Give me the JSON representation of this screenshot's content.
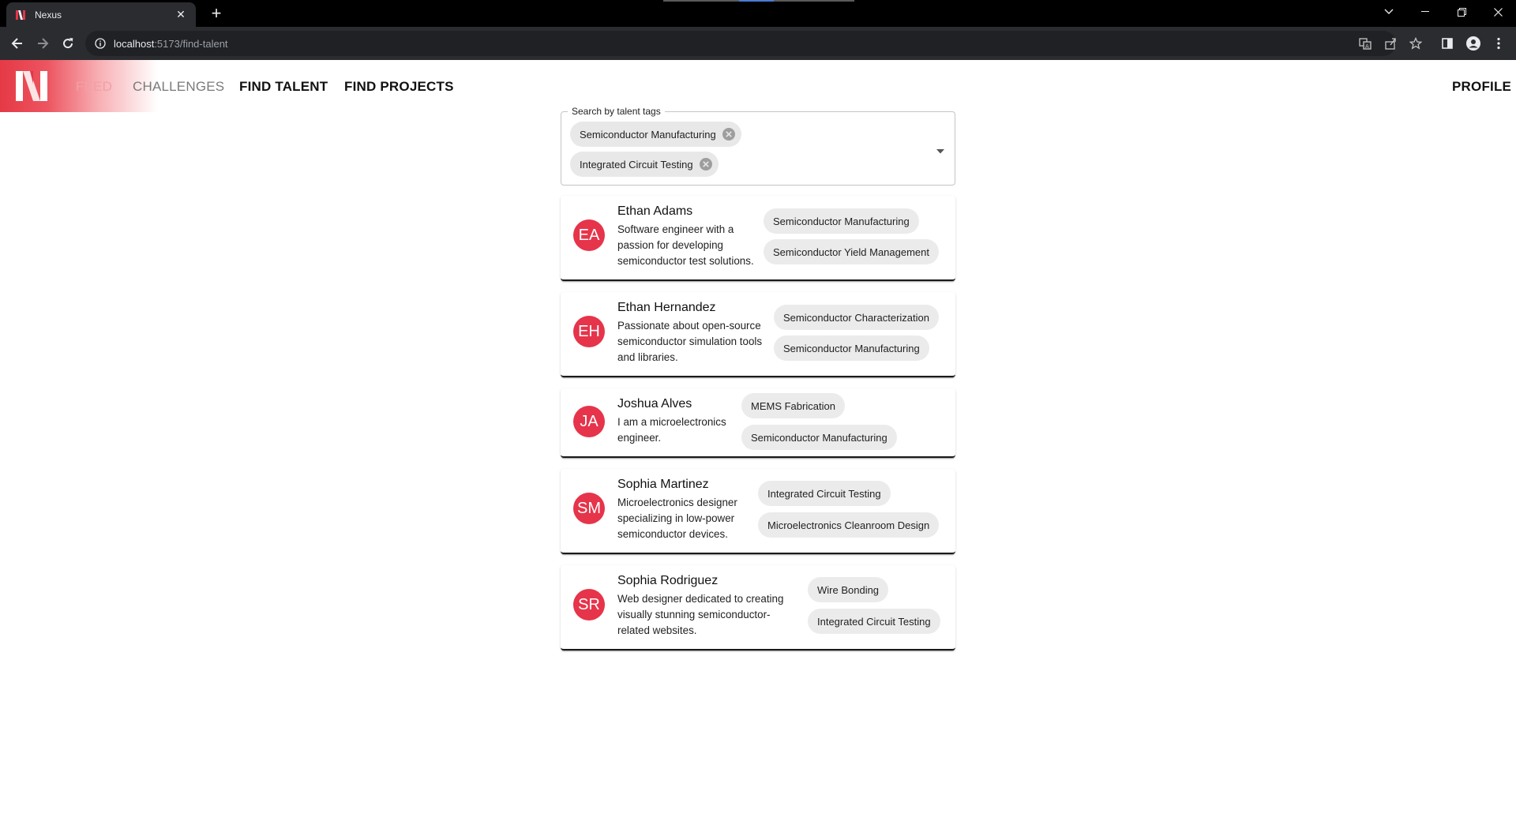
{
  "browser": {
    "tab_title": "Nexus",
    "url_host": "localhost",
    "url_path": ":5173/find-talent"
  },
  "nav": {
    "feed": "FEED",
    "challenges": "CHALLENGES",
    "find_talent": "FIND TALENT",
    "find_projects": "FIND PROJECTS",
    "profile": "PROFILE"
  },
  "search": {
    "label": "Search by talent tags",
    "selected_tags": [
      "Semiconductor Manufacturing",
      "Integrated Circuit Testing"
    ]
  },
  "results": [
    {
      "initials": "EA",
      "name": "Ethan Adams",
      "bio_lines": [
        "Software engineer with a",
        "passion for developing",
        "semiconductor test solutions."
      ],
      "tags": [
        "Semiconductor Manufacturing",
        "Semiconductor Yield Management"
      ]
    },
    {
      "initials": "EH",
      "name": "Ethan Hernandez",
      "bio_lines": [
        "Passionate about open-source",
        "semiconductor simulation tools",
        "and libraries."
      ],
      "tags": [
        "Semiconductor Characterization",
        "Semiconductor Manufacturing"
      ]
    },
    {
      "initials": "JA",
      "name": "Joshua Alves",
      "bio_lines": [
        "I am a microelectronics",
        "engineer."
      ],
      "tags": [
        "MEMS Fabrication",
        "Semiconductor Manufacturing"
      ]
    },
    {
      "initials": "SM",
      "name": "Sophia Martinez",
      "bio_lines": [
        "Microelectronics designer",
        "specializing in low-power",
        "semiconductor devices."
      ],
      "tags": [
        "Integrated Circuit Testing",
        "Microelectronics Cleanroom Design"
      ]
    },
    {
      "initials": "SR",
      "name": "Sophia Rodriguez",
      "bio_lines": [
        "Web designer dedicated to creating",
        "visually stunning semiconductor-",
        "related websites."
      ],
      "tags": [
        "Wire Bonding",
        "Integrated Circuit Testing"
      ]
    }
  ],
  "colors": {
    "brand_red": "#e6344a",
    "chip_bg": "#ebebeb"
  }
}
